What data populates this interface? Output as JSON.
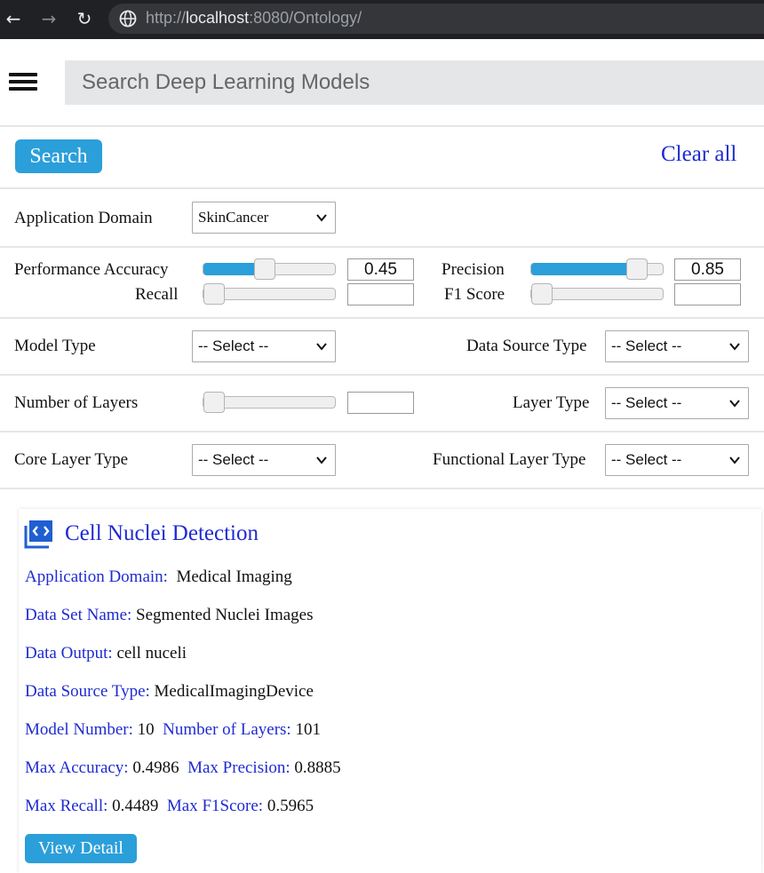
{
  "browser": {
    "url_prefix": "http://",
    "url_host": "localhost",
    "url_rest": ":8080/Ontology/"
  },
  "search": {
    "placeholder": "Search Deep Learning Models",
    "button_label": "Search",
    "clear_label": "Clear all"
  },
  "filters": {
    "application_domain": {
      "label": "Application Domain",
      "value": "SkinCancer"
    },
    "performance_accuracy": {
      "label": "Performance Accuracy",
      "value": "0.45",
      "level": 0.45
    },
    "precision": {
      "label": "Precision",
      "value": "0.85",
      "level": 0.85
    },
    "recall": {
      "label": "Recall",
      "value": "",
      "level": 0
    },
    "f1_score": {
      "label": "F1 Score",
      "value": "",
      "level": 0
    },
    "model_type": {
      "label": "Model Type",
      "value": "-- Select --"
    },
    "data_source_type": {
      "label": "Data Source Type",
      "value": "-- Select --"
    },
    "number_of_layers": {
      "label": "Number of Layers",
      "value": "",
      "level": 0
    },
    "layer_type": {
      "label": "Layer Type",
      "value": "-- Select --"
    },
    "core_layer_type": {
      "label": "Core Layer Type",
      "value": "-- Select --"
    },
    "functional_layer_type": {
      "label": "Functional Layer Type",
      "value": "-- Select --"
    }
  },
  "result": {
    "title": "Cell Nuclei Detection",
    "application_domain_key": "Application Domain:",
    "application_domain_value": "Medical Imaging",
    "data_set_name_key": "Data Set Name:",
    "data_set_name_value": "Segmented Nuclei Images",
    "data_output_key": "Data Output:",
    "data_output_value": "cell nuceli",
    "data_source_type_key": "Data Source Type:",
    "data_source_type_value": "MedicalImagingDevice",
    "model_number_key": "Model Number:",
    "model_number_value": "10",
    "number_of_layers_key": "Number of Layers:",
    "number_of_layers_value": "101",
    "max_accuracy_key": "Max Accuracy:",
    "max_accuracy_value": "0.4986",
    "max_precision_key": "Max Precision:",
    "max_precision_value": "0.8885",
    "max_recall_key": "Max Recall:",
    "max_recall_value": "0.4489",
    "max_f1score_key": "Max F1Score:",
    "max_f1score_value": "0.5965",
    "view_detail_label": "View Detail"
  },
  "colors": {
    "accent": "#2b9fd9",
    "link": "#1f2bd1"
  }
}
